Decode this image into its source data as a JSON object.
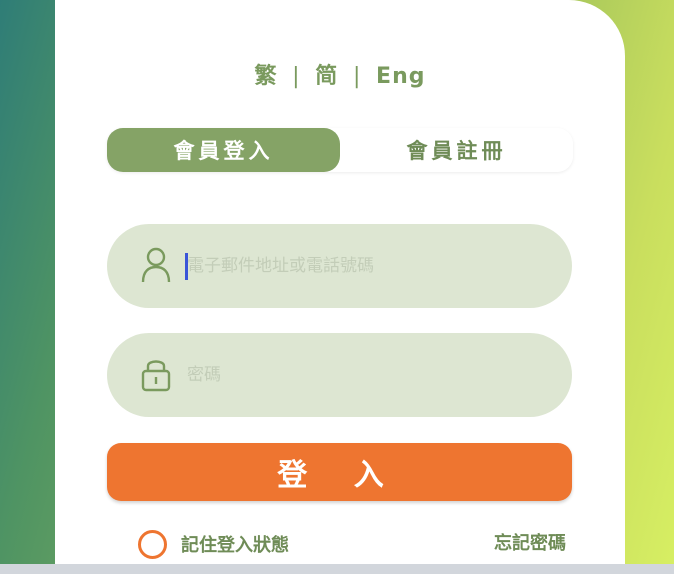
{
  "language_switcher": {
    "traditional": "繁",
    "simplified": "简",
    "english": "Eng",
    "separator": "|"
  },
  "tabs": {
    "login": "會員登入",
    "register": "會員註冊"
  },
  "fields": {
    "account_placeholder": "電子郵件地址或電話號碼",
    "password_placeholder": "密碼"
  },
  "login_button": "登 入",
  "remember_label": "記住登入狀態",
  "forgot_password": "忘記密碼",
  "colors": {
    "primary_green": "#85a366",
    "accent_orange": "#ee7530",
    "field_bg": "#dde6d2"
  }
}
